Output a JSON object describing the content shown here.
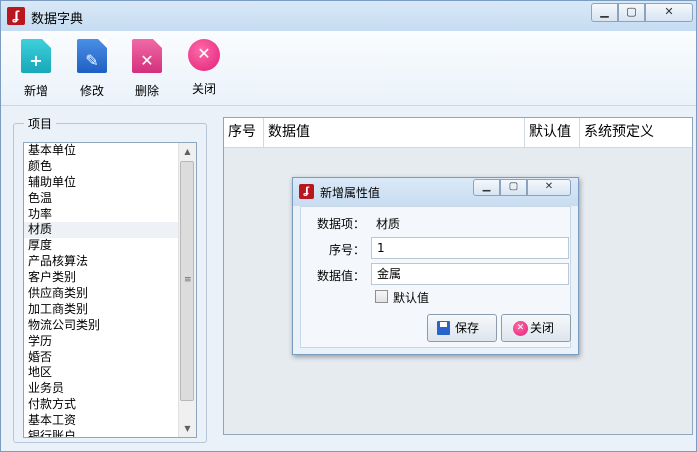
{
  "window": {
    "title": "数据字典",
    "minimize": "▁",
    "maximize": "▢",
    "close": "✕"
  },
  "toolbar": {
    "add_label": "新增",
    "edit_label": "修改",
    "delete_label": "删除",
    "close_label": "关闭",
    "add_glyph": "+",
    "edit_glyph": "✎",
    "delete_glyph": "✕",
    "close_glyph": "✕"
  },
  "sidebar": {
    "title": "项目",
    "items": [
      "基本单位",
      "颜色",
      "辅助单位",
      "色温",
      "功率",
      "材质",
      "厚度",
      "产品核算法",
      "客户类别",
      "供应商类别",
      "加工商类别",
      "物流公司类别",
      "学历",
      "婚否",
      "地区",
      "业务员",
      "付款方式",
      "基本工资",
      "银行账户"
    ],
    "selected_index": 5
  },
  "table": {
    "columns": [
      "序号",
      "数据值",
      "默认值",
      "系统预定义"
    ]
  },
  "dialog": {
    "title": "新增属性值",
    "data_item_label": "数据项：",
    "data_item_value": "材质",
    "index_label": "序号：",
    "index_value": "1",
    "value_label": "数据值：",
    "value_value": "金属",
    "default_label": "默认值",
    "default_checked": false,
    "save_label": "保存",
    "close_label": "关闭"
  },
  "colors": {
    "add": "#20b9c9",
    "edit": "#2b74d6",
    "delete": "#e0408a",
    "close": "#e0207a",
    "brand": "#b8171f"
  }
}
